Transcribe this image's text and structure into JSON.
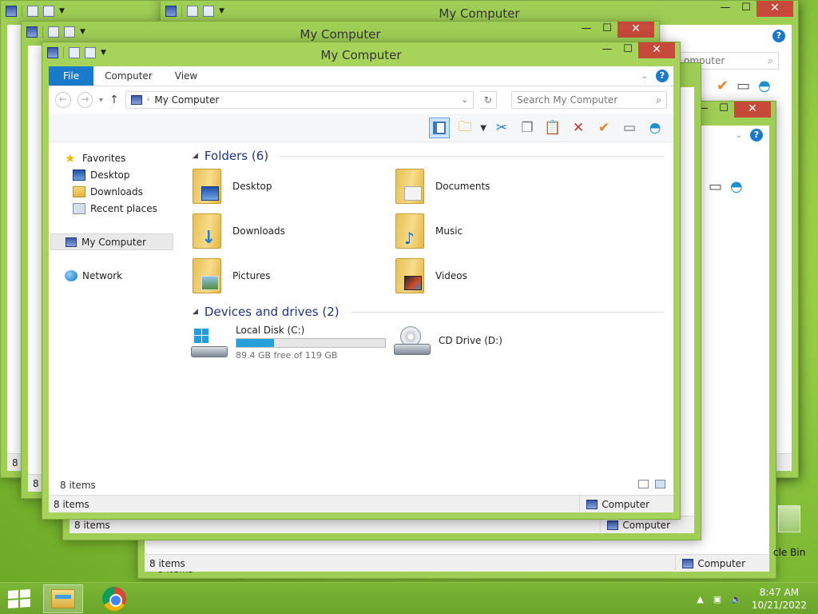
{
  "title": "My Computer",
  "ribbon": {
    "tabs": [
      "File",
      "Computer",
      "View"
    ]
  },
  "address": {
    "location": "My Computer"
  },
  "search": {
    "placeholder": "Search My Computer"
  },
  "sidebar": {
    "favorites": "Favorites",
    "favorites_items": [
      "Desktop",
      "Downloads",
      "Recent places"
    ],
    "computer": "My Computer",
    "network": "Network"
  },
  "folders": {
    "heading": "Folders (6)",
    "items": [
      "Desktop",
      "Documents",
      "Downloads",
      "Music",
      "Pictures",
      "Videos"
    ]
  },
  "devices": {
    "heading": "Devices and drives (2)",
    "drives": [
      {
        "name": "Local Disk (C:)",
        "free": "89.4 GB free of 119 GB",
        "used_fraction": 0.25
      },
      {
        "name": "CD Drive (D:)"
      }
    ]
  },
  "status": {
    "items": "8 items",
    "location": "Computer"
  },
  "bg_windows": {
    "search_fragment": "omputer"
  },
  "desktop": {
    "recycle_label": "cle Bin"
  },
  "taskbar": {
    "time": "8:47 AM",
    "date": "10/21/2022"
  },
  "colors": {
    "accent": "#1979ca",
    "frame": "#9fce55",
    "close": "#c7493a",
    "drive_bar": "#26a0da"
  }
}
